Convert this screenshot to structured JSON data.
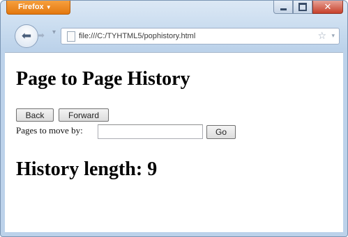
{
  "window": {
    "app_menu_label": "Firefox",
    "controls": {
      "minimize_label": "",
      "maximize_label": "",
      "close_label": "✕"
    }
  },
  "toolbar": {
    "url": "file:///C:/TYHTML5/pophistory.html"
  },
  "page": {
    "title": "Page to Page History",
    "back_label": "Back",
    "forward_label": "Forward",
    "pages_label": "Pages to move by:",
    "pages_value": "",
    "go_label": "Go",
    "history_text": "History length: 9"
  },
  "icons": {
    "back": "back-arrow-icon",
    "forward": "forward-arrow-icon",
    "page": "page-icon",
    "bookmark": "star-icon"
  }
}
